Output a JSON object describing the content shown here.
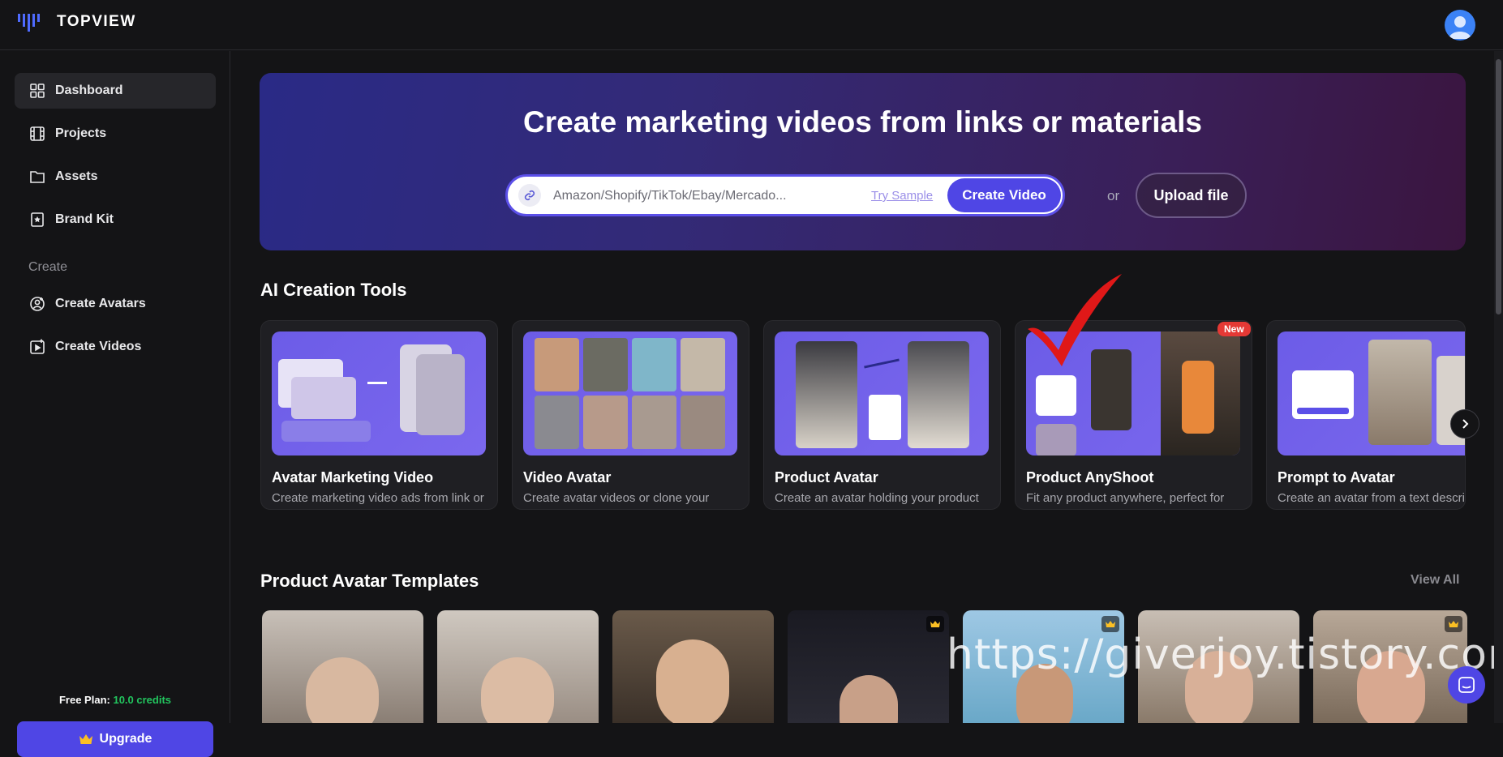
{
  "app": {
    "logo_text": "TOPVIEW"
  },
  "sidebar": {
    "items": [
      {
        "label": "Dashboard",
        "icon": "grid-icon"
      },
      {
        "label": "Projects",
        "icon": "film-icon"
      },
      {
        "label": "Assets",
        "icon": "folder-icon"
      },
      {
        "label": "Brand Kit",
        "icon": "star-bookmark-icon"
      }
    ],
    "create_section_label": "Create",
    "create_items": [
      {
        "label": "Create Avatars",
        "icon": "user-plus-icon"
      },
      {
        "label": "Create Videos",
        "icon": "video-plus-icon"
      }
    ],
    "plan_label": "Free Plan:",
    "plan_credits": "10.0 credits",
    "upgrade_label": "Upgrade"
  },
  "hero": {
    "title": "Create marketing videos from links or materials",
    "url_placeholder": "Amazon/Shopify/TikTok/Ebay/Mercado...",
    "try_sample": "Try Sample",
    "create_video": "Create Video",
    "or": "or",
    "upload_file": "Upload file"
  },
  "tools_section": {
    "title": "AI Creation Tools",
    "cards": [
      {
        "title": "Avatar Marketing Video",
        "desc": "Create marketing video ads from link or local materials"
      },
      {
        "title": "Video Avatar",
        "desc": "Create avatar videos or clone your avatar from a video"
      },
      {
        "title": "Product Avatar",
        "desc": "Create an avatar holding your product with one image"
      },
      {
        "title": "Product AnyShoot",
        "desc": "Fit any product anywhere, perfect for try-ons and product showcases",
        "badge": "New"
      },
      {
        "title": "Prompt to Avatar",
        "desc": "Create an avatar from a text description"
      }
    ]
  },
  "templates_section": {
    "title": "Product Avatar Templates",
    "view_all": "View All"
  },
  "watermark": "https://giverjoy.tistory.com",
  "colors": {
    "accent": "#4f46e5",
    "credits": "#22c55e",
    "badge": "#e53935",
    "checkmark": "#e01818"
  }
}
